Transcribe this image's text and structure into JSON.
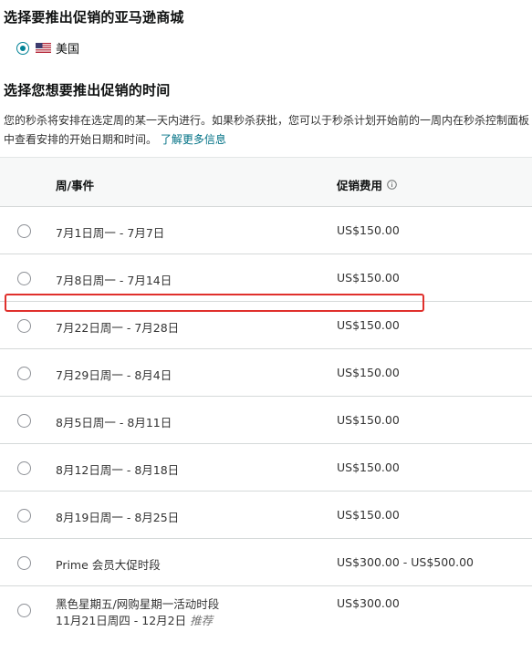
{
  "marketplace": {
    "title": "选择要推出促销的亚马逊商城",
    "selected_label": "美国",
    "flag_icon": "us-flag-icon"
  },
  "schedule": {
    "title": "选择您想要推出促销的时间",
    "description": "您的秒杀将安排在选定周的某一天内进行。如果秒杀获批，您可以于秒杀计划开始前的一周内在秒杀控制面板中查看安排的开始日期和时间。",
    "learn_more": "了解更多信息"
  },
  "table": {
    "headers": {
      "week": "周/事件",
      "fee": "促销费用",
      "fee_info_icon": "info-icon"
    },
    "rows": [
      {
        "week": "7月1日周一 - 7月7日",
        "fee": "US$150.00"
      },
      {
        "week": "7月8日周一 - 7月14日",
        "fee": "US$150.00"
      },
      {
        "week": "7月22日周一 - 7月28日",
        "fee": "US$150.00"
      },
      {
        "week": "7月29日周一 - 8月4日",
        "fee": "US$150.00"
      },
      {
        "week": "8月5日周一 - 8月11日",
        "fee": "US$150.00"
      },
      {
        "week": "8月12日周一 - 8月18日",
        "fee": "US$150.00"
      },
      {
        "week": "8月19日周一 - 8月25日",
        "fee": "US$150.00"
      },
      {
        "week": "Prime 会员大促时段",
        "fee": "US$300.00 - US$500.00"
      },
      {
        "week": "黑色星期五/网购星期一活动时段",
        "subline": "11月21日周四 - 12月2日",
        "tag": "推荐",
        "fee": "US$300.00"
      }
    ]
  },
  "colors": {
    "accent": "#008296",
    "link": "#007185",
    "highlight": "#e0302c"
  }
}
